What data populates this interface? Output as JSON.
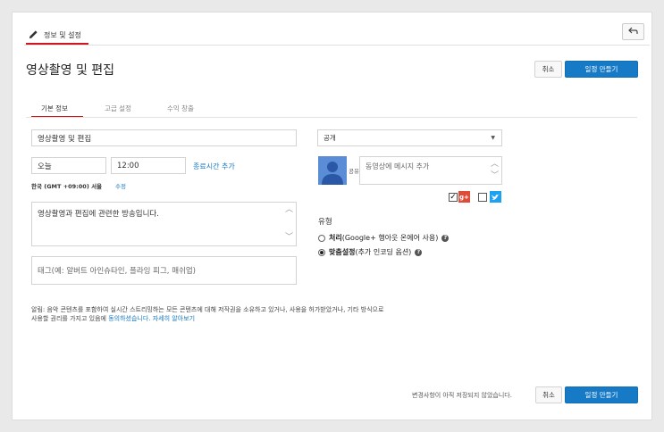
{
  "header": {
    "tab_label": "정보 및 설정",
    "back_icon": "undo-arrow-icon"
  },
  "page": {
    "title": "영상촬영 및 편집",
    "cancel_label": "취소",
    "create_label": "일정 만들기"
  },
  "tabs": [
    {
      "label": "기본 정보",
      "active": true
    },
    {
      "label": "고급 설정",
      "active": false
    },
    {
      "label": "수익 창출",
      "active": false
    }
  ],
  "form": {
    "title_value": "영상촬영 및 편집",
    "date_value": "오늘",
    "time_value": "12:00",
    "add_end_time_label": "종료시간 추가",
    "timezone_label": "한국 (GMT +09:00) 서울",
    "edit_label": "수정",
    "description_value": "영상촬영과 편집에 관련한 방송입니다.",
    "tags_placeholder": "태그(예: 알버트 아인슈타인, 플라잉 피그, 매쉬업)"
  },
  "privacy": {
    "selected": "공개"
  },
  "share": {
    "label": "공유",
    "message_placeholder": "동영상에 메시지 추가",
    "gplus_checked": true,
    "twitter_checked": false
  },
  "type_section": {
    "heading": "유형",
    "options": [
      {
        "bold": "처리",
        "rest": " (Google+ 행아웃 온에어 사용)",
        "checked": false
      },
      {
        "bold": "맞춤설정",
        "rest": " (추가 인코딩 옵션)",
        "checked": true
      }
    ]
  },
  "notice": {
    "text": "알림: 음악 콘텐츠를 포함하여 실시간 스트리밍하는 모든 콘텐츠에 대해 저작권을 소유하고 있거나, 사용을 허가받았거나, 기타 방식으로 사용할 권리를 가지고 있음에 ",
    "agree_link": "동의하셨습니다.",
    "more_link": "자세히 알아보기"
  },
  "footer": {
    "status": "변경사항이 아직 저장되지 않았습니다.",
    "cancel_label": "취소",
    "create_label": "일정 만들기"
  },
  "colors": {
    "accent_red": "#cc181e",
    "primary_blue": "#167ac6"
  }
}
